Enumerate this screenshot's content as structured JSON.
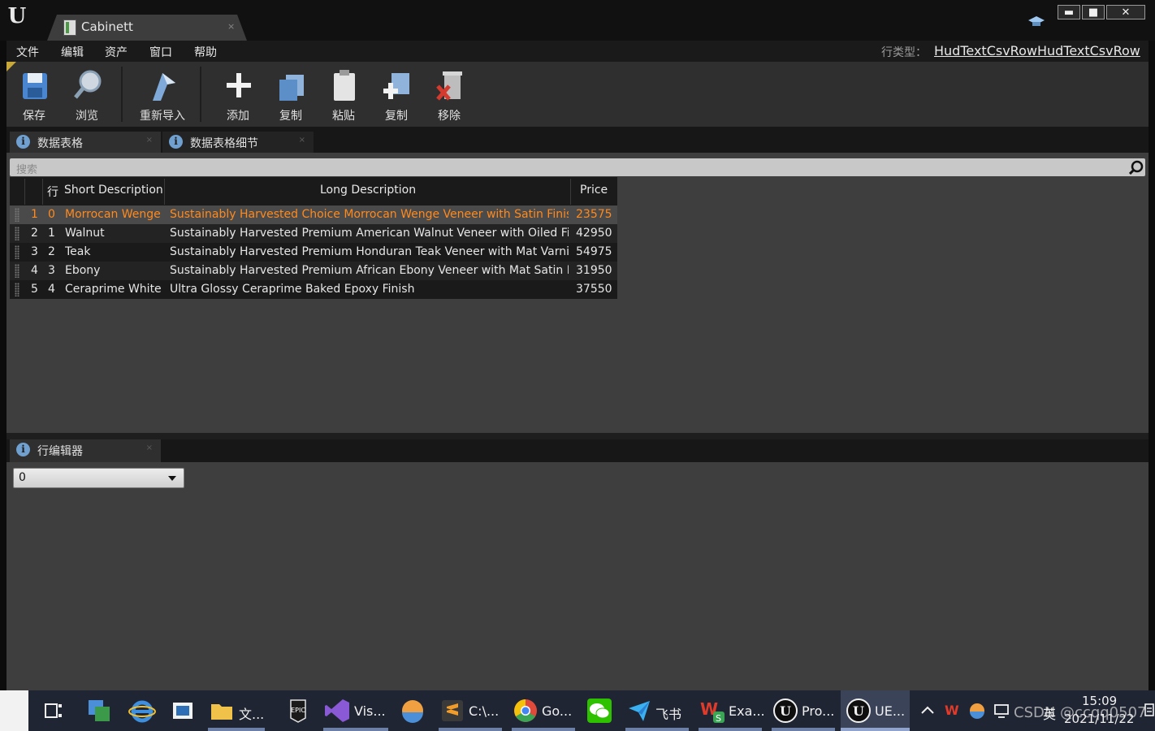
{
  "window": {
    "app_logo": "U",
    "tab_title": "Cabinett",
    "tab_close": "×",
    "min_label": "▬",
    "max_label": "■",
    "close_label": "✕"
  },
  "menu": {
    "items": [
      "文件",
      "编辑",
      "资产",
      "窗口",
      "帮助"
    ],
    "row_type_label": "行类型：",
    "row_type_value": "HudTextCsvRowHudTextCsvRow"
  },
  "toolbar": {
    "buttons": [
      {
        "label": "保存",
        "icon": "save-icon"
      },
      {
        "label": "浏览",
        "icon": "browse-icon"
      },
      {
        "label": "重新导入",
        "icon": "reimport-icon"
      },
      {
        "label": "添加",
        "icon": "add-icon"
      },
      {
        "label": "复制",
        "icon": "copy-icon"
      },
      {
        "label": "粘贴",
        "icon": "paste-icon"
      },
      {
        "label": "复制",
        "icon": "duplicate-icon"
      },
      {
        "label": "移除",
        "icon": "remove-icon"
      }
    ]
  },
  "panels": {
    "tab1": "数据表格",
    "tab2": "数据表格细节",
    "lower_tab": "行编辑器",
    "info_glyph": "i",
    "close_glyph": "×"
  },
  "search": {
    "placeholder": "搜索"
  },
  "table": {
    "headers": {
      "row": "行",
      "short": "Short Description",
      "long": "Long Description",
      "price": "Price"
    },
    "rows": [
      {
        "index": "1",
        "name": "0",
        "short": "Morrocan Wenge",
        "long": "Sustainably Harvested Choice Morrocan Wenge Veneer with Satin Finish",
        "price": "23575",
        "selected": true
      },
      {
        "index": "2",
        "name": "1",
        "short": "Walnut",
        "long": "Sustainably Harvested Premium American Walnut Veneer with Oiled Finish",
        "price": "42950",
        "selected": false
      },
      {
        "index": "3",
        "name": "2",
        "short": "Teak",
        "long": "Sustainably Harvested Premium Honduran Teak Veneer with Mat Varnish",
        "price": "54975",
        "selected": false
      },
      {
        "index": "4",
        "name": "3",
        "short": "Ebony",
        "long": "Sustainably Harvested Premium African Ebony Veneer with Mat Satin Finish",
        "price": "31950",
        "selected": false
      },
      {
        "index": "5",
        "name": "4",
        "short": "Ceraprime White",
        "long": "Ultra Glossy Ceraprime Baked Epoxy Finish",
        "price": "37550",
        "selected": false
      }
    ]
  },
  "row_editor": {
    "selected": "0"
  },
  "taskbar": {
    "apps": [
      {
        "name": "task-view-icon",
        "label": ""
      },
      {
        "name": "app-icon-1",
        "label": ""
      },
      {
        "name": "ie-icon",
        "label": ""
      },
      {
        "name": "app-icon-2",
        "label": ""
      },
      {
        "name": "folder-icon",
        "label": "文..."
      },
      {
        "name": "epic-icon",
        "label": ""
      },
      {
        "name": "vs-icon",
        "label": "Vis..."
      },
      {
        "name": "app-icon-3",
        "label": ""
      },
      {
        "name": "sublime-icon",
        "label": "C:\\..."
      },
      {
        "name": "chrome-icon",
        "label": "Go..."
      },
      {
        "name": "wechat-icon",
        "label": ""
      },
      {
        "name": "feishu-icon",
        "label": "飞书"
      },
      {
        "name": "excel-icon",
        "label": "Exa..."
      },
      {
        "name": "unreal-icon-1",
        "label": "Pro..."
      },
      {
        "name": "unreal-icon-2",
        "label": "UE..."
      }
    ],
    "tray_time": "15:09",
    "tray_date": "2021/11/22",
    "watermark": "CSDN @ccqq0507",
    "tray_ime": "英"
  },
  "colors": {
    "selected_row": "#ff8a1e",
    "accent_blue": "#6fa0cf"
  }
}
